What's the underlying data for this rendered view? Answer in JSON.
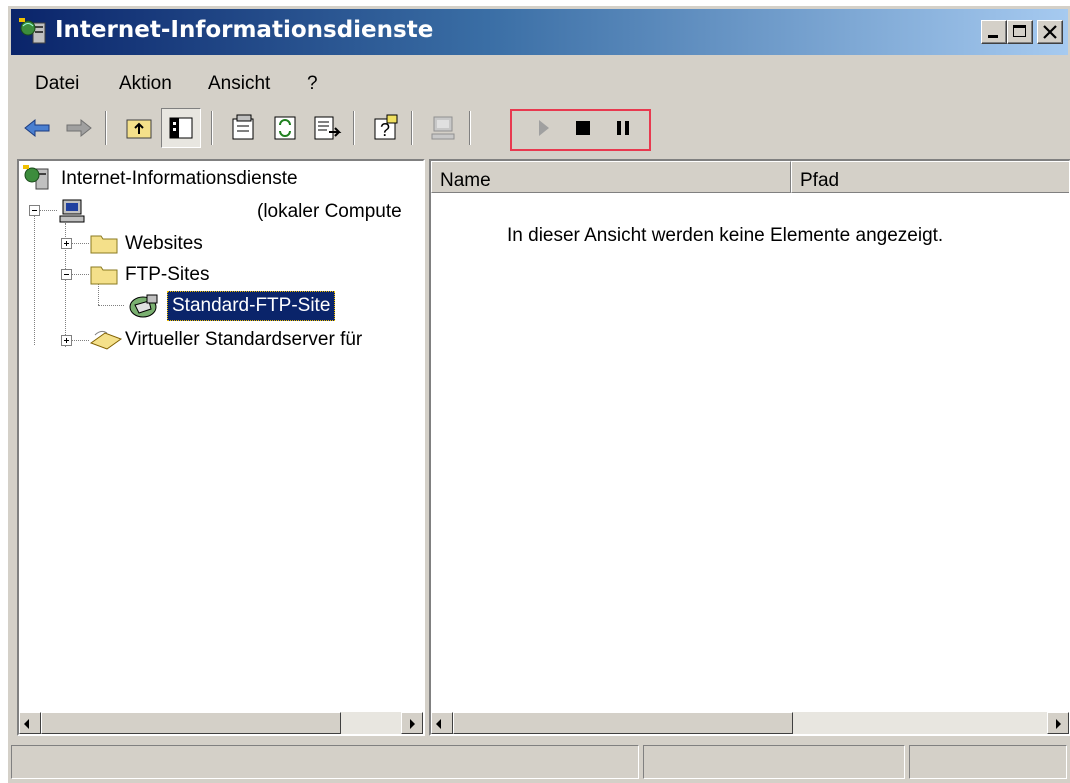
{
  "window": {
    "title": "Internet-Informationsdienste"
  },
  "menu": [
    {
      "label": "Datei"
    },
    {
      "label": "Aktion"
    },
    {
      "label": "Ansicht"
    },
    {
      "label": "?"
    }
  ],
  "toolbar": {
    "icons": [
      "back-arrow-icon",
      "forward-arrow-icon",
      "up-folder-icon",
      "show-tree-icon",
      "properties-icon",
      "refresh-icon",
      "export-list-icon",
      "help-icon",
      "computer-icon",
      "start-icon",
      "stop-icon",
      "pause-icon"
    ]
  },
  "tree": {
    "root": "Internet-Informationsdienste",
    "computer": "(lokaler Compute",
    "websites": "Websites",
    "ftp_sites": "FTP-Sites",
    "ftp_default": "Standard-FTP-Site",
    "smtp": "Virtueller Standardserver für"
  },
  "list": {
    "columns": [
      "Name",
      "Pfad"
    ],
    "empty_message": "In dieser Ansicht werden keine Elemente angezeigt."
  },
  "colors": {
    "title_start": "#0a246a",
    "title_end": "#a6caf0",
    "selection": "#0a246a",
    "highlight_box": "#e8394f"
  }
}
